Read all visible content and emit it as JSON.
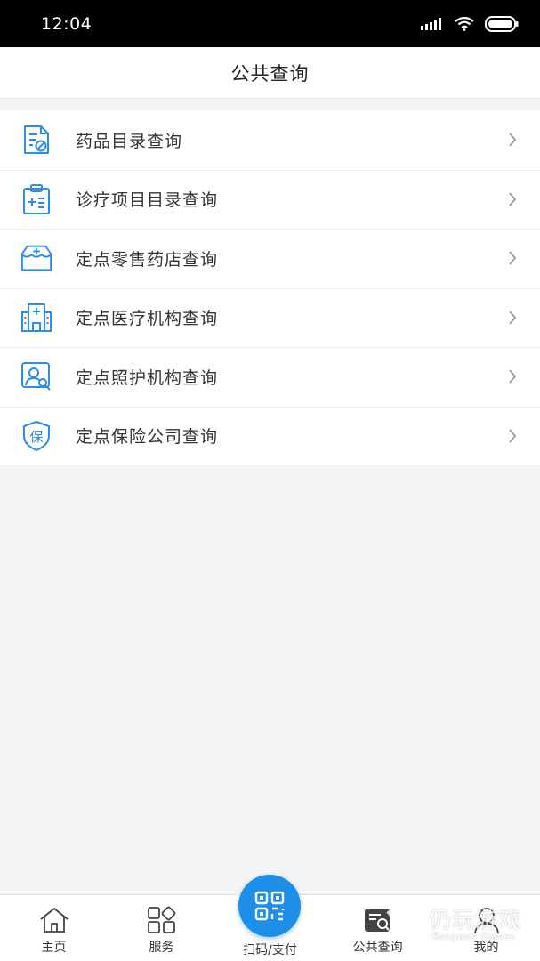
{
  "status_bar": {
    "time": "12:04"
  },
  "header": {
    "title": "公共查询"
  },
  "items": [
    {
      "label": "药品目录查询",
      "icon": "drug-catalog-icon"
    },
    {
      "label": "诊疗项目目录查询",
      "icon": "clipboard-medical-icon"
    },
    {
      "label": "定点零售药店查询",
      "icon": "pharmacy-box-icon"
    },
    {
      "label": "定点医疗机构查询",
      "icon": "hospital-building-icon"
    },
    {
      "label": "定点照护机构查询",
      "icon": "care-person-search-icon"
    },
    {
      "label": "定点保险公司查询",
      "icon": "insurance-shield-icon"
    }
  ],
  "tabs": {
    "home": "主页",
    "services": "服务",
    "scan": "扫码/支付",
    "public_query": "公共查询",
    "mine": "我的"
  },
  "watermark": {
    "text": "仍玩游戏",
    "sub": "Rengwan Games"
  },
  "colors": {
    "accent": "#1e8fe8",
    "status_bar": "#000000",
    "background": "#f4f4f4"
  }
}
